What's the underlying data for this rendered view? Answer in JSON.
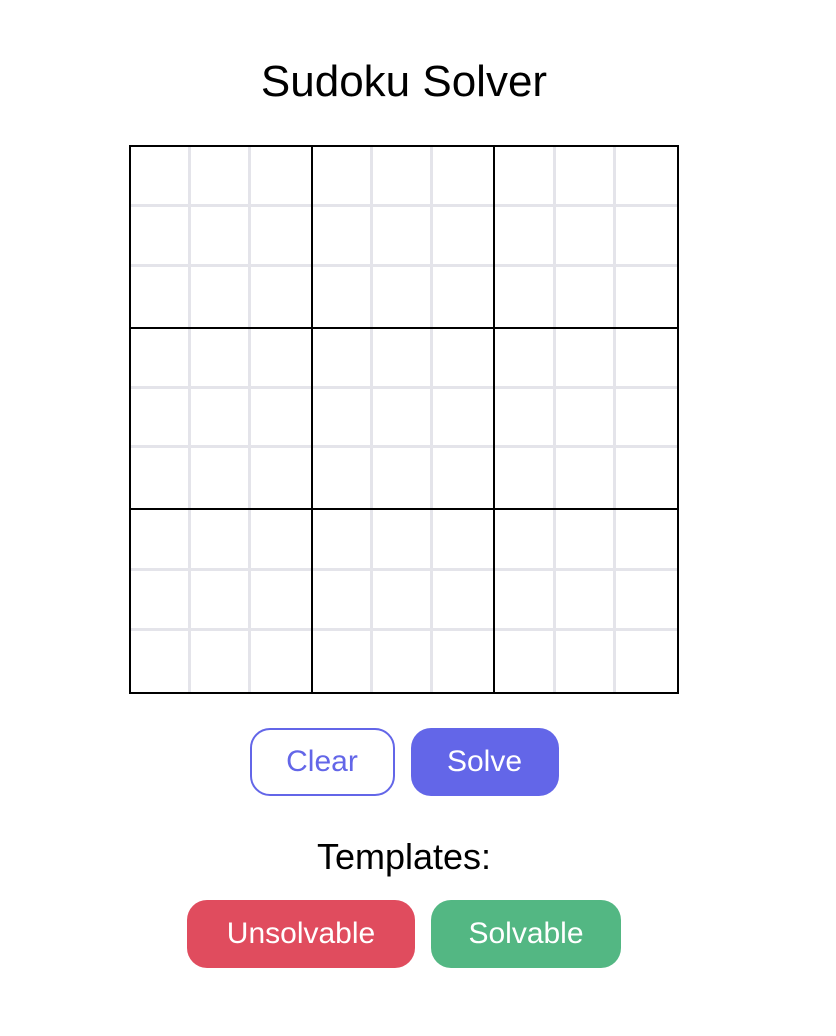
{
  "header": {
    "title": "Sudoku Solver"
  },
  "board": {
    "rows": 9,
    "cols": 9,
    "cells": [
      [
        "",
        "",
        "",
        "",
        "",
        "",
        "",
        "",
        ""
      ],
      [
        "",
        "",
        "",
        "",
        "",
        "",
        "",
        "",
        ""
      ],
      [
        "",
        "",
        "",
        "",
        "",
        "",
        "",
        "",
        ""
      ],
      [
        "",
        "",
        "",
        "",
        "",
        "",
        "",
        "",
        ""
      ],
      [
        "",
        "",
        "",
        "",
        "",
        "",
        "",
        "",
        ""
      ],
      [
        "",
        "",
        "",
        "",
        "",
        "",
        "",
        "",
        ""
      ],
      [
        "",
        "",
        "",
        "",
        "",
        "",
        "",
        "",
        ""
      ],
      [
        "",
        "",
        "",
        "",
        "",
        "",
        "",
        "",
        ""
      ],
      [
        "",
        "",
        "",
        "",
        "",
        "",
        "",
        "",
        ""
      ]
    ]
  },
  "actions": {
    "clear_label": "Clear",
    "solve_label": "Solve"
  },
  "templates": {
    "label": "Templates:",
    "unsolvable_label": "Unsolvable",
    "solvable_label": "Solvable"
  },
  "colors": {
    "primary": "#6366e8",
    "danger": "#e04c5e",
    "success": "#53b783",
    "grid_line_light": "#e4e4ea",
    "grid_line_dark": "#000000"
  }
}
